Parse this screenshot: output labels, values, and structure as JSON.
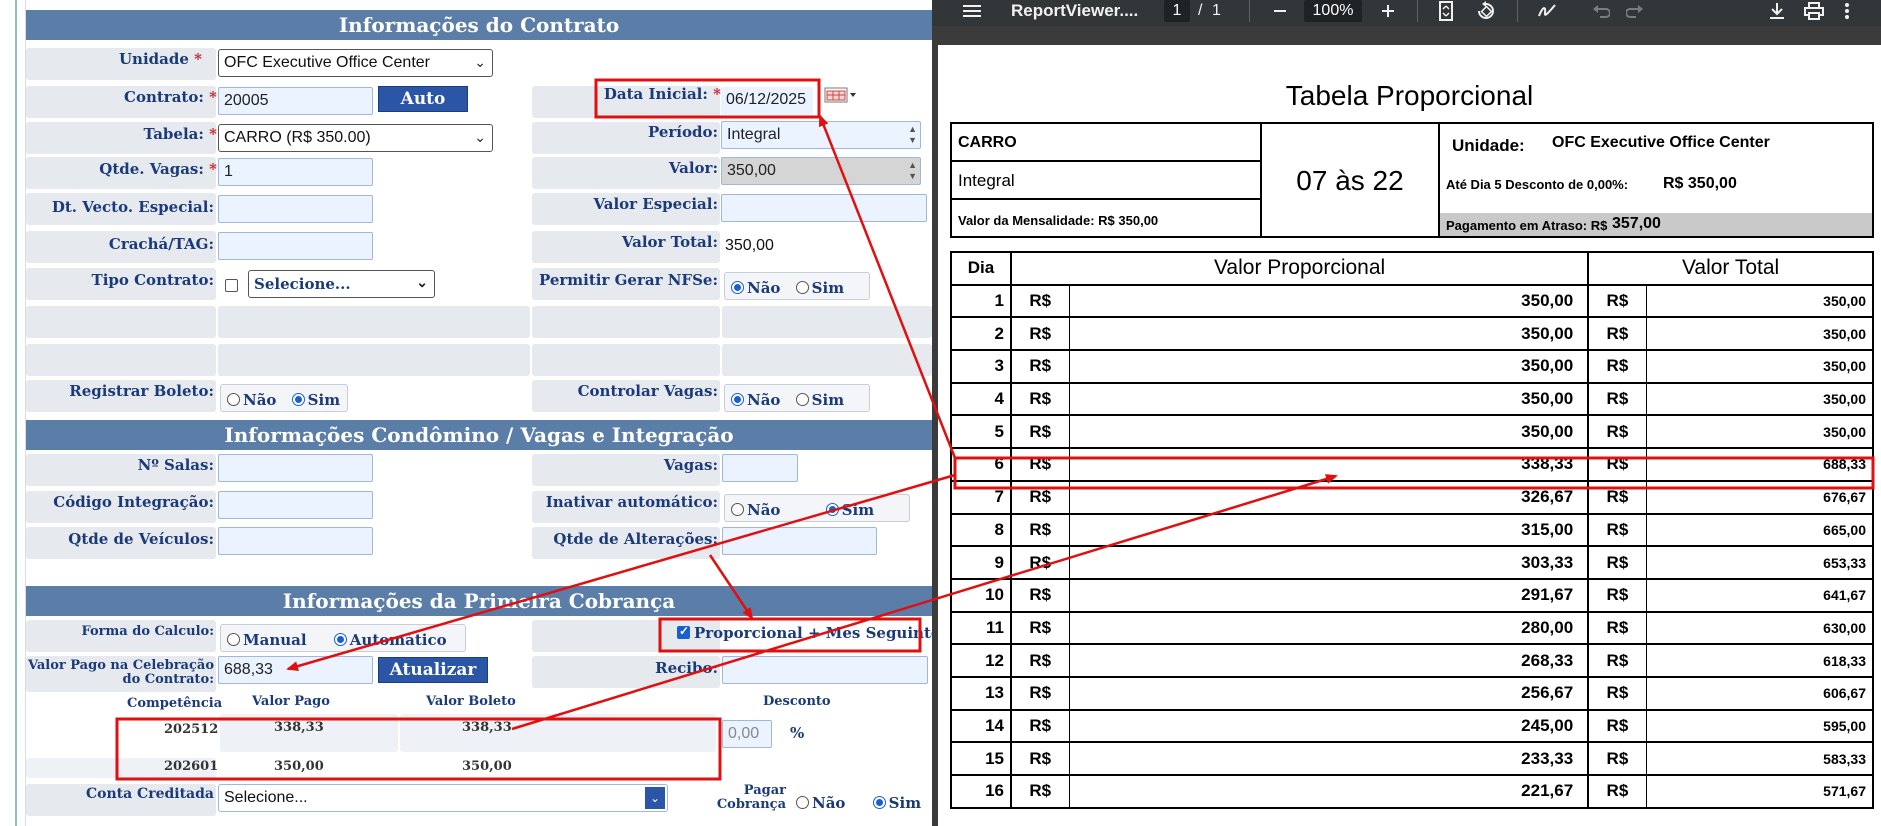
{
  "form": {
    "sections": {
      "contrato": "Informações do Contrato",
      "condomino": "Informações Condômino / Vagas e Integração",
      "cobranca": "Informações da Primeira Cobrança"
    },
    "unidade": {
      "label": "Unidade",
      "value": "OFC Executive Office Center"
    },
    "contrato": {
      "label": "Contrato:",
      "value": "20005",
      "auto_button": "Auto"
    },
    "data_inicial": {
      "label": "Data Inicial:",
      "value": "06/12/2025"
    },
    "tabela": {
      "label": "Tabela:",
      "value": "CARRO (R$ 350.00)"
    },
    "periodo": {
      "label": "Período:",
      "value": "Integral"
    },
    "qtde_vagas": {
      "label": "Qtde. Vagas:",
      "value": "1"
    },
    "valor": {
      "label": "Valor:",
      "value": "350,00"
    },
    "dt_vecto": {
      "label": "Dt. Vecto. Especial:",
      "value": ""
    },
    "valor_especial": {
      "label": "Valor Especial:",
      "value": ""
    },
    "cracha": {
      "label": "Crachá/TAG:",
      "value": ""
    },
    "valor_total": {
      "label": "Valor Total:",
      "value": "350,00"
    },
    "tipo_contrato": {
      "label": "Tipo Contrato:",
      "value": "Selecione..."
    },
    "permitir_nfse": {
      "label": "Permitir Gerar NFSe:",
      "opt_nao": "Não",
      "opt_sim": "Sim",
      "selected": "Não"
    },
    "registrar_boleto": {
      "label": "Registrar Boleto:",
      "opt_nao": "Não",
      "opt_sim": "Sim",
      "selected": "Sim"
    },
    "controlar_vagas": {
      "label": "Controlar Vagas:",
      "opt_nao": "Não",
      "opt_sim": "Sim",
      "selected": "Não"
    },
    "n_salas": {
      "label": "Nº Salas:",
      "value": ""
    },
    "vagas": {
      "label": "Vagas:",
      "value": ""
    },
    "codigo_integracao": {
      "label": "Código Integração:",
      "value": ""
    },
    "inativar": {
      "label": "Inativar automático:",
      "opt_nao": "Não",
      "opt_sim": "Sim",
      "selected": "Sim"
    },
    "qtde_veiculos": {
      "label": "Qtde de Veículos:",
      "value": ""
    },
    "qtde_alteracoes": {
      "label": "Qtde de Alterações:",
      "value": ""
    },
    "forma_calculo": {
      "label": "Forma do Calculo:",
      "opt_manual": "Manual",
      "opt_auto": "Automático",
      "selected": "Automático"
    },
    "proporcional": {
      "label": "Proporcional + Mes Seguinte",
      "checked": true
    },
    "valor_pago": {
      "label_line1": "Valor Pago na Celebração",
      "label_line2": "do Contrato:",
      "value": "688,33",
      "button": "Atualizar"
    },
    "recibo": {
      "label": "Recibo:",
      "value": ""
    },
    "comp_table": {
      "headers": [
        "Competência",
        "Valor Pago",
        "Valor Boleto",
        "Desconto"
      ],
      "rows": [
        {
          "competencia": "202512",
          "valor_pago": "338,33",
          "valor_boleto": "338,33"
        },
        {
          "competencia": "202601",
          "valor_pago": "350,00",
          "valor_boleto": "350,00"
        }
      ],
      "desconto_value": "0,00",
      "percent": "%"
    },
    "conta_creditada": {
      "label": "Conta Creditada",
      "value": "Selecione..."
    },
    "pagar_cobranca": {
      "label_line1": "Pagar",
      "label_line2": "Cobrança",
      "opt_nao": "Não",
      "opt_sim": "Sim",
      "selected": "Sim"
    }
  },
  "viewer": {
    "filename": "ReportViewer....",
    "page_current": "1",
    "page_sep": "/",
    "page_total": "1",
    "zoom": "100%",
    "icons": [
      "menu-icon",
      "zoom-out-icon",
      "zoom-in-icon",
      "fit-page-icon",
      "rotate-icon",
      "draw-icon",
      "undo-icon",
      "redo-icon",
      "download-icon",
      "print-icon",
      "more-icon"
    ]
  },
  "report": {
    "title": "Tabela Proporcional",
    "tabela": "CARRO",
    "periodo": "Integral",
    "mensalidade": "Valor da Mensalidade: R$ 350,00",
    "horario": "07 às 22",
    "unidade_label": "Unidade:",
    "unidade_value": "OFC Executive Office Center",
    "desconto_label": "Até Dia 5 Desconto de 0,00%:",
    "desconto_value": "R$ 350,00",
    "atraso_label": "Pagamento em Atraso: R$",
    "atraso_value": "357,00",
    "headers": [
      "Dia",
      "Valor Proporcional",
      "Valor Total"
    ],
    "currency": "R$",
    "rows": [
      {
        "dia": "1",
        "proporcional": "350,00",
        "total": "350,00"
      },
      {
        "dia": "2",
        "proporcional": "350,00",
        "total": "350,00"
      },
      {
        "dia": "3",
        "proporcional": "350,00",
        "total": "350,00"
      },
      {
        "dia": "4",
        "proporcional": "350,00",
        "total": "350,00"
      },
      {
        "dia": "5",
        "proporcional": "350,00",
        "total": "350,00"
      },
      {
        "dia": "6",
        "proporcional": "338,33",
        "total": "688,33"
      },
      {
        "dia": "7",
        "proporcional": "326,67",
        "total": "676,67"
      },
      {
        "dia": "8",
        "proporcional": "315,00",
        "total": "665,00"
      },
      {
        "dia": "9",
        "proporcional": "303,33",
        "total": "653,33"
      },
      {
        "dia": "10",
        "proporcional": "291,67",
        "total": "641,67"
      },
      {
        "dia": "11",
        "proporcional": "280,00",
        "total": "630,00"
      },
      {
        "dia": "12",
        "proporcional": "268,33",
        "total": "618,33"
      },
      {
        "dia": "13",
        "proporcional": "256,67",
        "total": "606,67"
      },
      {
        "dia": "14",
        "proporcional": "245,00",
        "total": "595,00"
      },
      {
        "dia": "15",
        "proporcional": "233,33",
        "total": "583,33"
      },
      {
        "dia": "16",
        "proporcional": "221,67",
        "total": "571,67"
      }
    ]
  },
  "colors": {
    "section_header": "#5b7ea9",
    "label_text": "#1b3a78",
    "button": "#2b55a6",
    "annotation": "#e01010",
    "viewer_toolbar": "#323639"
  }
}
